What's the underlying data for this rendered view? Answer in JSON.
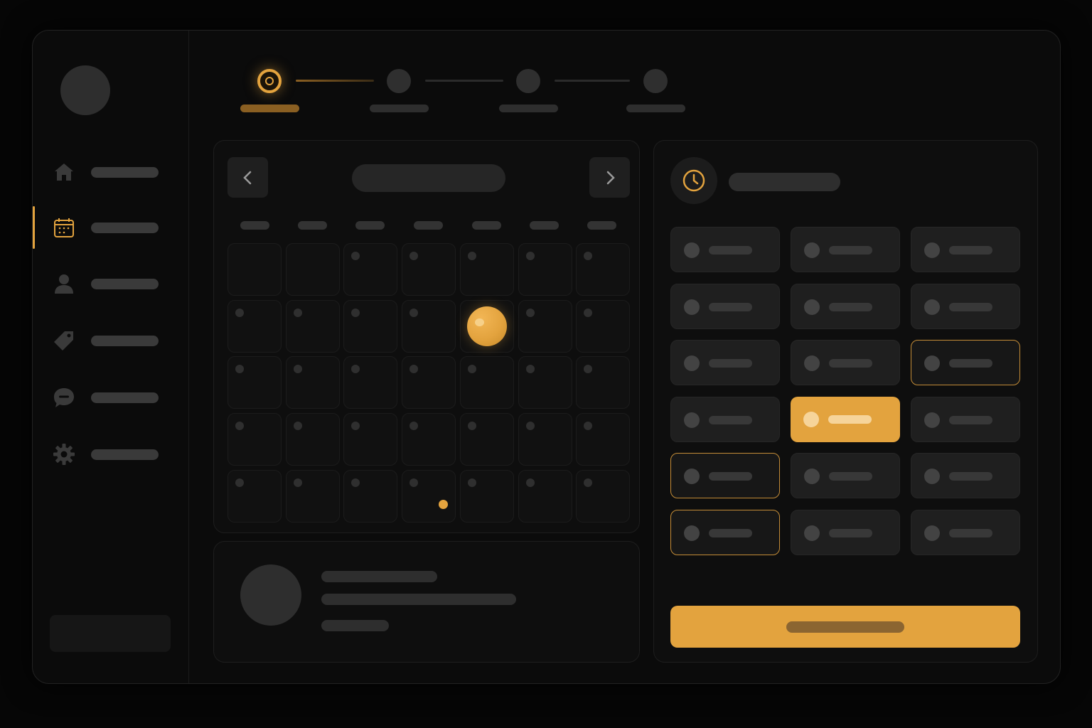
{
  "colors": {
    "accent": "#e3a33e",
    "background": "#060606",
    "surface": "#0b0b0b",
    "placeholder": "#2e2e2e"
  },
  "sidebar": {
    "items": [
      {
        "icon": "home-icon",
        "label": "",
        "active": false
      },
      {
        "icon": "calendar-icon",
        "label": "",
        "active": true
      },
      {
        "icon": "user-icon",
        "label": "",
        "active": false
      },
      {
        "icon": "tag-icon",
        "label": "",
        "active": false
      },
      {
        "icon": "chat-icon",
        "label": "",
        "active": false
      },
      {
        "icon": "gear-icon",
        "label": "",
        "active": false
      }
    ],
    "bottom_label": ""
  },
  "stepper": {
    "current_step": 1,
    "total_steps": 4,
    "steps": [
      {
        "label": ""
      },
      {
        "label": ""
      },
      {
        "label": ""
      },
      {
        "label": ""
      }
    ]
  },
  "calendar": {
    "month_label": "",
    "prev_icon": "chevron-left-icon",
    "next_icon": "chevron-right-icon",
    "weekdays": [
      "",
      "",
      "",
      "",
      "",
      "",
      ""
    ],
    "rows": 5,
    "columns": 7,
    "empty_leading_days": 2,
    "selected_cell": {
      "row": 1,
      "col": 4
    },
    "event_cell": {
      "row": 4,
      "col": 3
    }
  },
  "profile": {
    "name": "",
    "subtitle": "",
    "meta": ""
  },
  "time_panel": {
    "icon": "clock-icon",
    "title": "",
    "columns": 3,
    "rows": 6,
    "selected_slot": 10,
    "outlined_slots": [
      8,
      12,
      15
    ],
    "confirm_label": ""
  }
}
